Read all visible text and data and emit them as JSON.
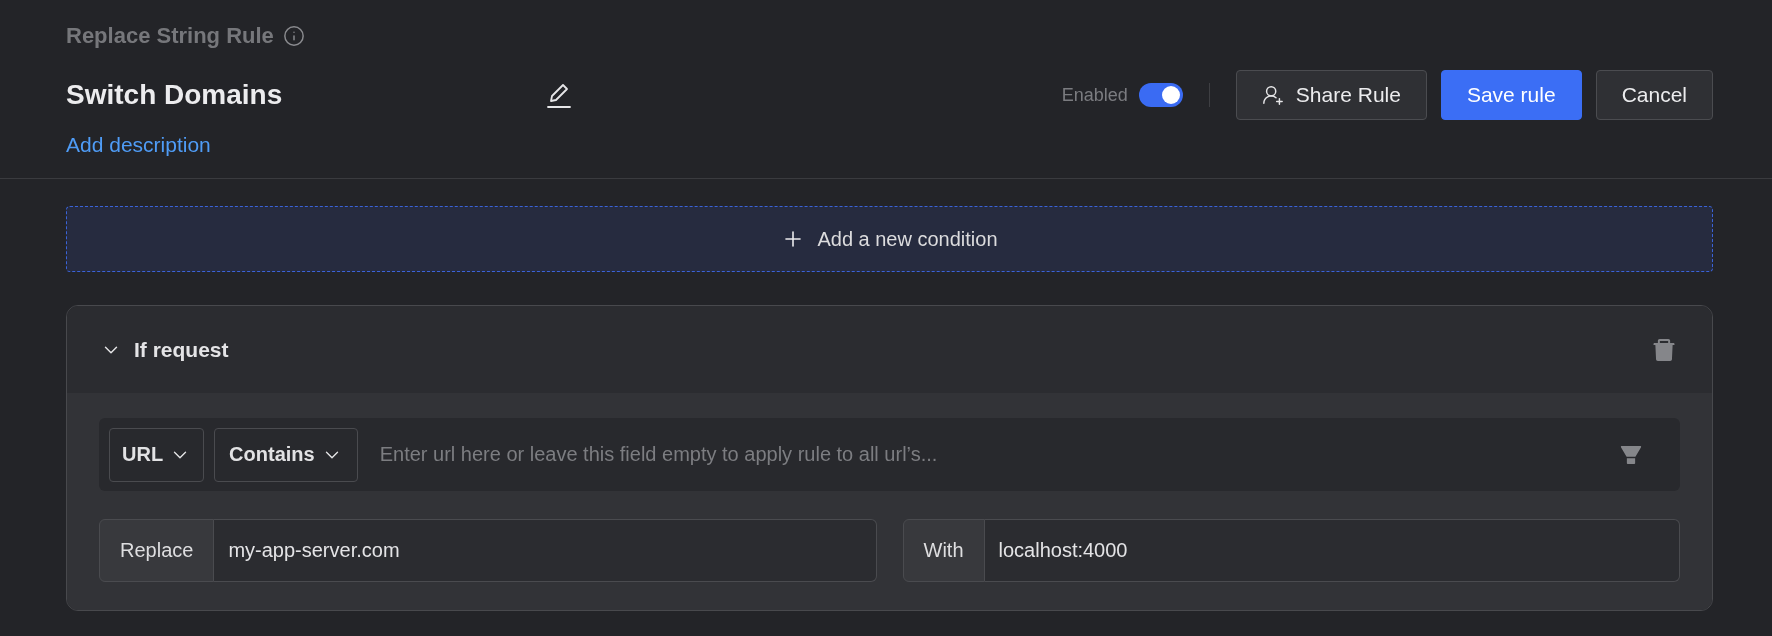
{
  "header": {
    "rule_type": "Replace String Rule",
    "rule_name": "Switch Domains",
    "description_link": "Add description",
    "enabled": {
      "label": "Enabled",
      "on": true
    },
    "buttons": [
      {
        "label": "Share Rule",
        "kind": "share"
      },
      {
        "label": "Save rule",
        "kind": "primary"
      },
      {
        "label": "Cancel",
        "kind": "secondary"
      }
    ]
  },
  "add_condition": {
    "label": "Add a new condition"
  },
  "condition": {
    "title": "If request",
    "expanded": true,
    "source_key": "URL",
    "operator": "Contains",
    "url_field": {
      "placeholder": "Enter url here or leave this field empty to apply rule to all url’s..."
    },
    "pairs": [
      {
        "label": "Replace",
        "value": "my-app-server.com"
      },
      {
        "label": "With",
        "value": "localhost:4000"
      }
    ]
  }
}
